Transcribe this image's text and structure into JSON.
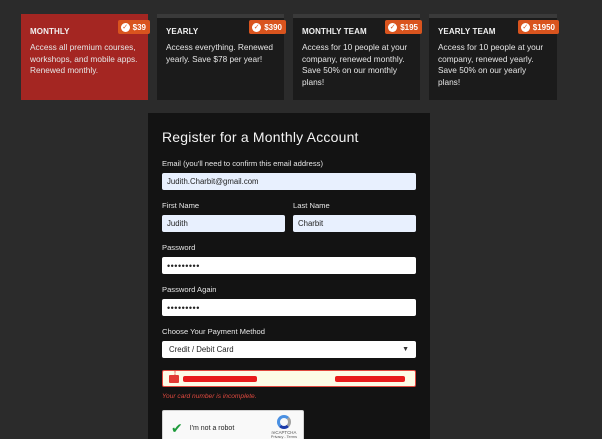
{
  "plans": [
    {
      "name": "MONTHLY",
      "price": "$39",
      "desc": "Access all premium courses, workshops, and mobile apps. Renewed monthly.",
      "active": true
    },
    {
      "name": "YEARLY",
      "price": "$390",
      "desc": "Access everything. Renewed yearly. Save $78 per year!",
      "active": false
    },
    {
      "name": "MONTHLY TEAM",
      "price": "$195",
      "desc": "Access for 10 people at your company, renewed monthly. Save 50% on our monthly plans!",
      "active": false
    },
    {
      "name": "YEARLY TEAM",
      "price": "$1950",
      "desc": "Access for 10 people at your company, renewed yearly. Save 50% on our yearly plans!",
      "active": false
    }
  ],
  "form": {
    "title": "Register for a Monthly Account",
    "email_label": "Email (you'll need to confirm this email address)",
    "email_value": "Judith.Charbit@gmail.com",
    "first_name_label": "First Name",
    "first_name_value": "Judith",
    "last_name_label": "Last Name",
    "last_name_value": "Charbit",
    "password_label": "Password",
    "password_value": "•••••••••",
    "password_again_label": "Password Again",
    "password_again_value": "•••••••••",
    "payment_label": "Choose Your Payment Method",
    "payment_selected": "Credit / Debit Card",
    "card_error": "Your card number is incomplete.",
    "captcha_label": "I'm not a robot",
    "captcha_brand": "reCAPTCHA",
    "captcha_links": "Privacy - Terms"
  },
  "colors": {
    "accent": "#a42622",
    "badge": "#d9541e",
    "error": "#e0493f"
  },
  "icons": {
    "badge_check": "check-circle-icon",
    "select_arrow": "chevron-down-icon",
    "card_error": "card-error-icon",
    "captcha_check": "checkmark-icon",
    "captcha_logo": "recaptcha-icon"
  }
}
